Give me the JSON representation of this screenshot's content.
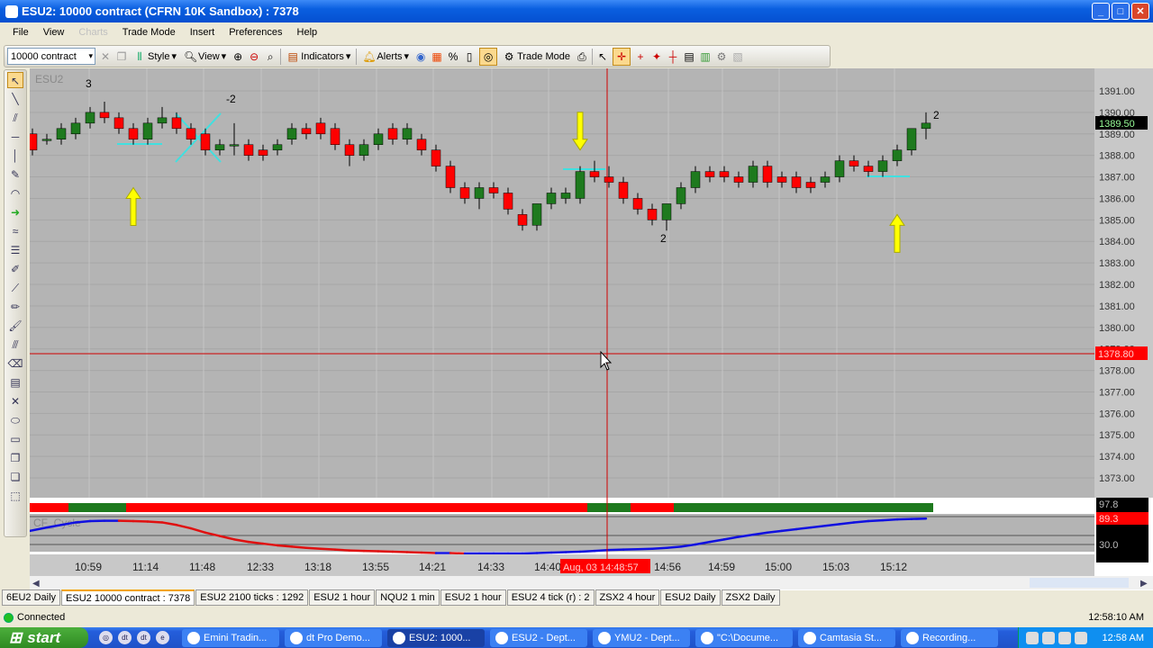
{
  "window": {
    "title": "ESU2: 10000 contract (CFRN 10K Sandbox) : 7378"
  },
  "menu": [
    "File",
    "View",
    "Charts",
    "Trade Mode",
    "Insert",
    "Preferences",
    "Help"
  ],
  "toolbar": {
    "interval": "10000 contract",
    "style": "Style",
    "view": "View",
    "indicators": "Indicators",
    "alerts": "Alerts",
    "trade_mode": "Trade Mode"
  },
  "chart": {
    "symbol": "ESU2",
    "price_labels": [
      "1391.00",
      "1390.00",
      "1389.00",
      "1388.00",
      "1387.00",
      "1386.00",
      "1385.00",
      "1384.00",
      "1383.00",
      "1382.00",
      "1381.00",
      "1380.00",
      "1379.00",
      "1378.00",
      "1377.00",
      "1376.00",
      "1375.00",
      "1374.00",
      "1373.00"
    ],
    "last_price": "1389.50",
    "crosshair_price": "1378.80",
    "crosshair_time": "Aug, 03 14:48:57",
    "time_labels": [
      "10:59",
      "11:14",
      "11:48",
      "12:33",
      "13:18",
      "13:55",
      "14:21",
      "14:33",
      "14:40",
      "14:56",
      "14:59",
      "15:00",
      "15:03",
      "15:12"
    ],
    "annotations": [
      "3",
      "-2",
      "2",
      "2"
    ],
    "indicator_name": "CF_Cycle",
    "indicator_labels": [
      "97.8",
      "89.3",
      "30.0"
    ],
    "colors": {
      "up": "#1e7a1e",
      "down": "#ff0000",
      "cycle_up": "#1010e0",
      "cycle_down": "#e01010",
      "crosshair": "#d00000",
      "arrow": "#ffff00",
      "drawing": "#40e0e0"
    }
  },
  "chart_data": {
    "type": "candlestick",
    "ylim": [
      1372.5,
      1391.5
    ],
    "ohlc": [
      [
        1389,
        1389.25,
        1388,
        1388.25
      ],
      [
        1388.75,
        1389,
        1388.5,
        1388.75
      ],
      [
        1388.75,
        1389.5,
        1388.5,
        1389.25
      ],
      [
        1389,
        1389.75,
        1388.75,
        1389.5
      ],
      [
        1389.5,
        1390.25,
        1389.25,
        1390
      ],
      [
        1390,
        1390.5,
        1389.5,
        1389.75
      ],
      [
        1389.75,
        1390,
        1389,
        1389.25
      ],
      [
        1389.25,
        1389.5,
        1388.5,
        1388.75
      ],
      [
        1388.75,
        1389.75,
        1388.5,
        1389.5
      ],
      [
        1389.5,
        1390.25,
        1389.25,
        1389.75
      ],
      [
        1389.75,
        1390,
        1389,
        1389.25
      ],
      [
        1389.25,
        1389.5,
        1388.5,
        1388.75
      ],
      [
        1389,
        1389.25,
        1388,
        1388.25
      ],
      [
        1388.25,
        1388.75,
        1388,
        1388.5
      ],
      [
        1388.5,
        1389.5,
        1388,
        1388.5
      ],
      [
        1388.5,
        1388.75,
        1387.75,
        1388
      ],
      [
        1388.25,
        1388.5,
        1387.75,
        1388
      ],
      [
        1388.25,
        1388.75,
        1388,
        1388.5
      ],
      [
        1388.75,
        1389.5,
        1388.5,
        1389.25
      ],
      [
        1389.25,
        1389.5,
        1388.75,
        1389
      ],
      [
        1389.5,
        1389.75,
        1388.75,
        1389
      ],
      [
        1389.25,
        1389.5,
        1388.25,
        1388.5
      ],
      [
        1388.5,
        1388.75,
        1387.5,
        1388
      ],
      [
        1388,
        1388.75,
        1387.75,
        1388.5
      ],
      [
        1388.5,
        1389.25,
        1388.25,
        1389
      ],
      [
        1389.25,
        1389.5,
        1388.5,
        1388.75
      ],
      [
        1388.75,
        1389.5,
        1388.5,
        1389.25
      ],
      [
        1388.75,
        1389,
        1388,
        1388.25
      ],
      [
        1388.25,
        1388.5,
        1387.25,
        1387.5
      ],
      [
        1387.5,
        1387.75,
        1386.25,
        1386.5
      ],
      [
        1386.5,
        1386.75,
        1385.75,
        1386
      ],
      [
        1386,
        1386.75,
        1385.5,
        1386.5
      ],
      [
        1386.5,
        1386.75,
        1386,
        1386.25
      ],
      [
        1386.25,
        1386.5,
        1385.25,
        1385.5
      ],
      [
        1385.25,
        1385.5,
        1384.5,
        1384.75
      ],
      [
        1384.75,
        1385.75,
        1384.5,
        1385.75
      ],
      [
        1385.75,
        1386.5,
        1385.5,
        1386.25
      ],
      [
        1386,
        1386.5,
        1385.75,
        1386.25
      ],
      [
        1386,
        1387.5,
        1385.75,
        1387.25
      ],
      [
        1387.25,
        1387.75,
        1386.75,
        1387
      ],
      [
        1387,
        1387.5,
        1386.5,
        1386.75
      ],
      [
        1386.75,
        1387,
        1385.75,
        1386
      ],
      [
        1386,
        1386.25,
        1385.25,
        1385.5
      ],
      [
        1385.5,
        1385.75,
        1384.75,
        1385
      ],
      [
        1385,
        1385.75,
        1384.5,
        1385.75
      ],
      [
        1385.75,
        1386.75,
        1385.5,
        1386.5
      ],
      [
        1386.5,
        1387.5,
        1386.25,
        1387.25
      ],
      [
        1387.25,
        1387.5,
        1386.75,
        1387
      ],
      [
        1387.25,
        1387.5,
        1386.75,
        1387
      ],
      [
        1387,
        1387.25,
        1386.5,
        1386.75
      ],
      [
        1386.75,
        1387.75,
        1386.5,
        1387.5
      ],
      [
        1387.5,
        1387.75,
        1386.5,
        1386.75
      ],
      [
        1387,
        1387.25,
        1386.5,
        1386.75
      ],
      [
        1387,
        1387.25,
        1386.25,
        1386.5
      ],
      [
        1386.75,
        1387,
        1386.25,
        1386.5
      ],
      [
        1386.75,
        1387.25,
        1386.5,
        1387
      ],
      [
        1387,
        1388,
        1386.75,
        1387.75
      ],
      [
        1387.75,
        1388,
        1387.25,
        1387.5
      ],
      [
        1387.5,
        1387.75,
        1387,
        1387.25
      ],
      [
        1387.25,
        1388,
        1387,
        1387.75
      ],
      [
        1387.75,
        1388.5,
        1387.5,
        1388.25
      ],
      [
        1388.25,
        1389.25,
        1388,
        1389.25
      ],
      [
        1389.25,
        1390,
        1388.75,
        1389.5
      ]
    ],
    "trend_segments": [
      {
        "from": 0,
        "to": 2,
        "state": "down"
      },
      {
        "from": 3,
        "to": 6,
        "state": "up"
      },
      {
        "from": 7,
        "to": 38,
        "state": "down"
      },
      {
        "from": 39,
        "to": 41,
        "state": "up"
      },
      {
        "from": 42,
        "to": 44,
        "state": "down"
      },
      {
        "from": 45,
        "to": 62,
        "state": "up"
      }
    ],
    "cycle": [
      62,
      70,
      76,
      82,
      85,
      86,
      86,
      85,
      84,
      82,
      76,
      68,
      58,
      50,
      42,
      36,
      32,
      28,
      25,
      22,
      20,
      18,
      16,
      15,
      14,
      13,
      12,
      11,
      10,
      10,
      9,
      9,
      9,
      9,
      9,
      10,
      11,
      12,
      13,
      15,
      17,
      18,
      19,
      20,
      22,
      25,
      30,
      36,
      42,
      48,
      53,
      58,
      62,
      66,
      70,
      74,
      78,
      82,
      85,
      87,
      89,
      90,
      91
    ],
    "arrows": [
      {
        "bar": 7,
        "dir": "up",
        "price": 1386.5
      },
      {
        "bar": 38,
        "dir": "down",
        "price": 1388.25
      },
      {
        "bar": 60,
        "dir": "up",
        "price": 1385.25
      }
    ]
  },
  "tabs": [
    "6EU2 Daily",
    "ESU2 10000 contract : 7378",
    "ESU2 2100 ticks : 1292",
    "ESU2 1 hour",
    "NQU2 1 min",
    "ESU2 1 hour",
    "ESU2 4 tick (r) : 2",
    "ZSX2 4 hour",
    "ESU2 Daily",
    "ZSX2 Daily"
  ],
  "status": {
    "connection": "Connected",
    "time": "12:58:10 AM"
  },
  "taskbar": {
    "start": "start",
    "tasks": [
      "Emini Tradin...",
      "dt Pro Demo...",
      "ESU2: 1000...",
      "ESU2 - Dept...",
      "YMU2 - Dept...",
      "\"C:\\Docume...",
      "Camtasia St...",
      "Recording..."
    ],
    "clock": "12:58 AM"
  }
}
